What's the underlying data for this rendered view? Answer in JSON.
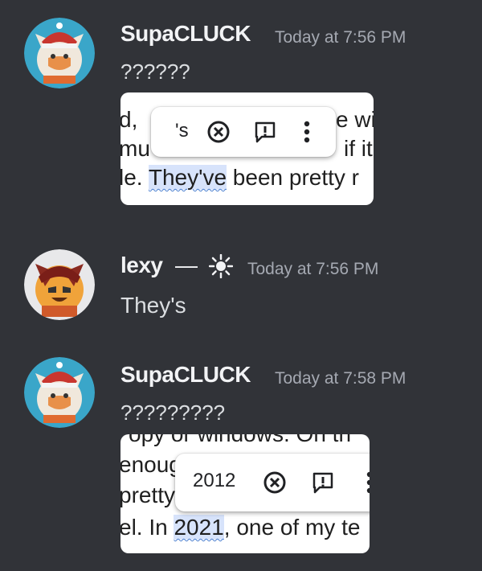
{
  "messages": [
    {
      "username": "SupaCLUCK",
      "timestamp": "Today at 7:56 PM",
      "content": "??????",
      "attachment": {
        "lines": [
          "d, ",
          "mu",
          "le. They've been pretty r"
        ],
        "highlight_word": "They've",
        "right_fragments": [
          "e wi",
          "if it"
        ]
      },
      "popup": {
        "suggestion": "'s"
      }
    },
    {
      "username": "lexy",
      "separator": "—",
      "timestamp": "Today at 7:56 PM",
      "content": "They's"
    },
    {
      "username": "SupaCLUCK",
      "timestamp": "Today at 7:58 PM",
      "content": "?????????",
      "attachment": {
        "lines": [
          "opy or windows. On th",
          "enoug",
          "pretty",
          "el. In 2021, one of my te"
        ],
        "highlight_word": "2021"
      },
      "popup": {
        "suggestion": "2012"
      }
    }
  ],
  "icons": [
    "close-circle-icon",
    "report-icon",
    "more-vertical-icon",
    "sun-icon"
  ],
  "colors": {
    "background": "#313338",
    "username": "#f2f3f5",
    "timestamp": "#a5a9b2",
    "text": "#dbdee1"
  }
}
